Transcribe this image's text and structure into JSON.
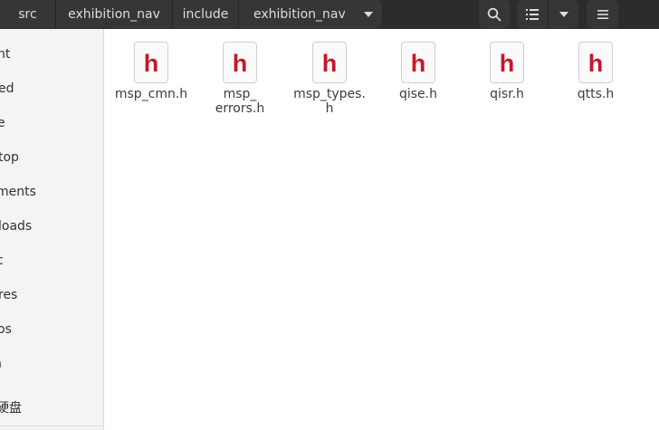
{
  "breadcrumbs": [
    "src",
    "exhibition_nav",
    "include",
    "exhibition_nav"
  ],
  "header": {
    "search_icon": "search-icon",
    "view_icon": "list-view-icon",
    "menu_icon": "hamburger-menu-icon"
  },
  "sidebar": {
    "items": [
      {
        "label": "nt"
      },
      {
        "label": "ed"
      },
      {
        "label": "e"
      },
      {
        "label": "top"
      },
      {
        "label": "ments"
      },
      {
        "label": "loads"
      },
      {
        "label": "c"
      },
      {
        "label": "res"
      },
      {
        "label": "os"
      },
      {
        "label": "h"
      },
      {
        "label": "硬盘"
      }
    ]
  },
  "files": [
    {
      "icon_letter": "h",
      "name": "msp_cmn.h"
    },
    {
      "icon_letter": "h",
      "name": "msp_\nerrors.h"
    },
    {
      "icon_letter": "h",
      "name": "msp_types.\nh"
    },
    {
      "icon_letter": "h",
      "name": "qise.h"
    },
    {
      "icon_letter": "h",
      "name": "qisr.h"
    },
    {
      "icon_letter": "h",
      "name": "qtts.h"
    }
  ],
  "colors": {
    "accent": "#c7162b",
    "headerbar": "#2c2c2c",
    "sidebar": "#f4f4f4"
  }
}
